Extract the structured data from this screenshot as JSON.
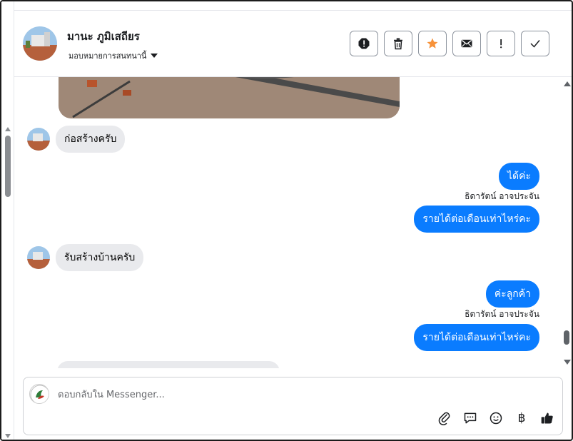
{
  "header": {
    "contact_name": "มานะ ภูมิเสถียร",
    "assign_label": "มอบหมายการสนทนานี้",
    "actions": [
      {
        "name": "spam-button",
        "icon": "alert-octagon-icon"
      },
      {
        "name": "delete-button",
        "icon": "trash-icon"
      },
      {
        "name": "star-button",
        "icon": "star-icon"
      },
      {
        "name": "mark-unread-button",
        "icon": "envelope-icon"
      },
      {
        "name": "follow-up-button",
        "icon": "exclamation-icon"
      },
      {
        "name": "mark-done-button",
        "icon": "check-icon"
      }
    ]
  },
  "messages": [
    {
      "direction": "in",
      "text": "ก่อสร้างครับ"
    },
    {
      "direction": "out",
      "text": "ได้ค่ะ"
    },
    {
      "direction": "out",
      "sender": "ธิดารัตน์ อาจประจัน",
      "text": "รายได้ต่อเดือนเท่าไหร่คะ"
    },
    {
      "direction": "in",
      "text": "รับสร้างบ้านครับ"
    },
    {
      "direction": "out",
      "text": "ค่ะลูกค้า"
    },
    {
      "direction": "out",
      "sender": "ธิดารัตน์ อาจประจัน",
      "text": "รายได้ต่อเดือนเท่าไหร่คะ"
    }
  ],
  "composer": {
    "placeholder": "ตอบกลับใน Messenger...",
    "tools": [
      "paperclip-icon",
      "speech-bubble-icon",
      "emoji-icon",
      "baht-icon",
      "thumbs-up-icon"
    ],
    "baht_symbol": "฿"
  },
  "colors": {
    "outgoing_bubble": "#0a7cff",
    "incoming_bubble": "#e9eaed",
    "star": "#f7923a"
  }
}
